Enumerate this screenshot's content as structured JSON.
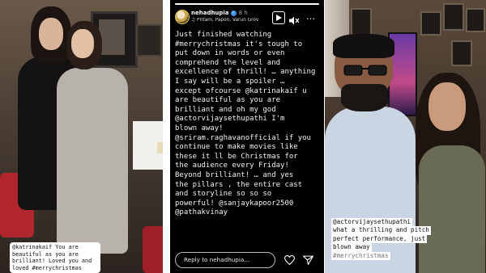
{
  "left_panel": {
    "caption_lines": [
      "@katrinakaif You are",
      "beautiful as you are",
      "brilliant! Loved you and",
      "loved #merrychristmas"
    ]
  },
  "story": {
    "username": "nehadhupia",
    "verified_mark": "✓",
    "time_ago": "8 h",
    "music": "Pritam, Papon, Varun Grov",
    "more_label": "…",
    "text": "Just finished watching\n#merrychristmas it's tough to\nput down in words or even\ncomprehend the level and\nexcellence of thrill! … anything\nI say will be a spoiler …\nexcept ofcourse @katrinakaif u\nare beautiful as you are\nbrilliant and oh my god\n@actorvijaysethupathi I'm\nblown away!\n@sriram.raghavanofficial if you\ncontinue to make movies like\nthese it ll be Christmas for\nthe audience every Friday!\nBeyond brilliant! … and yes\nthe pillars , the entire cast\nand storyline so so so\npowerful! @sanjaykapoor2500\n@pathakvinay",
    "reply_placeholder": "Reply to nehadhupia...",
    "progress": 1.0,
    "icons": [
      "play-icon",
      "mute-icon",
      "more-icon",
      "heart-icon",
      "send-icon"
    ]
  },
  "right_panel": {
    "caption_lines": [
      "@actorvijaysethupathi",
      "what a thrilling and pitch",
      "perfect performance, just",
      "blown away",
      "#merrychristmas"
    ]
  },
  "colors": {
    "story_bg": "#000000",
    "verified": "#3897f0"
  }
}
